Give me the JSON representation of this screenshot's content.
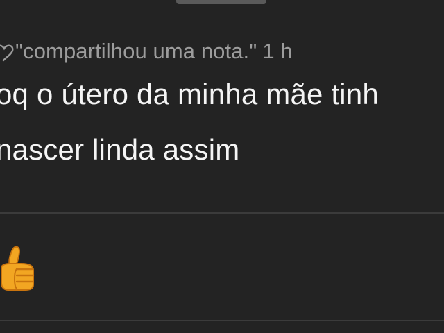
{
  "note": {
    "meta_text": "\"compartilhou uma nota.\"",
    "timestamp": "1 h",
    "text_line_1": "oq o útero da minha mãe tinh",
    "text_line_2": "nascer linda assim"
  },
  "reactions": {
    "icon": "thumbs-up-icon",
    "color": "#f2a622"
  },
  "colors": {
    "background": "#232323",
    "primary_text": "#f5f5f5",
    "secondary_text": "#9c9c9c",
    "divider": "#3b3b3b"
  }
}
